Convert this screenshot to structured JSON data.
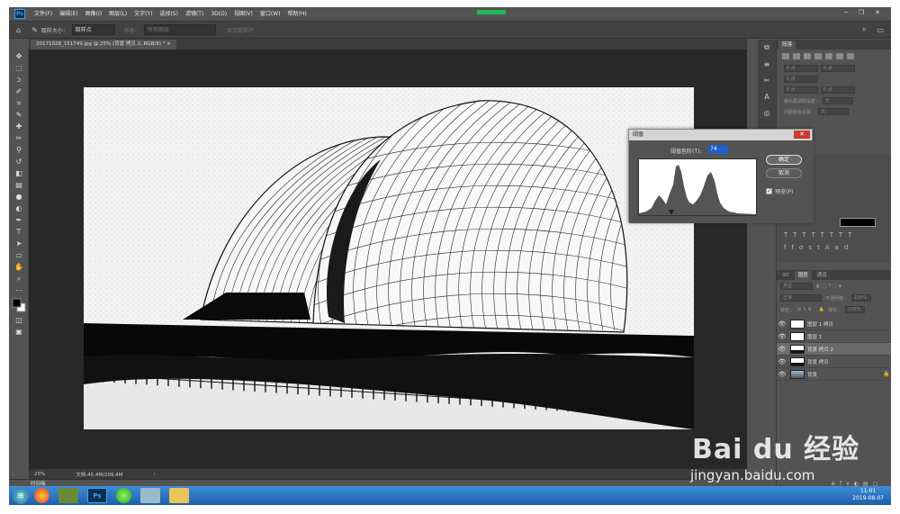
{
  "app": {
    "logo": "Ps",
    "menus": [
      "文件(F)",
      "编辑(E)",
      "图像(I)",
      "图层(L)",
      "文字(Y)",
      "选择(S)",
      "滤镜(T)",
      "3D(D)",
      "视图(V)",
      "窗口(W)",
      "帮助(H)"
    ]
  },
  "options": {
    "sample_size_label": "取样大小：",
    "sample_size_value": "取样点",
    "sample_label": "样本：",
    "sample_value": "所有图层",
    "show_ring": "显示取样环"
  },
  "document": {
    "tab_title": "20171028_151749.jpg @ 25% (背景 拷贝 2, RGB/8) *"
  },
  "status": {
    "zoom": "25%",
    "doc_size": "文档:45.4M/209.4M",
    "timeline": "时间轴"
  },
  "panels": {
    "paragraph_tab": "段落",
    "para_fields": [
      "0 点",
      "0 点",
      "0 点",
      "0 点",
      "0 点"
    ],
    "hyphen_label": "避头尾法则设置：",
    "hyphen_value": "无",
    "spacing_label": "间距组合设置：",
    "spacing_value": "无",
    "layer_tabs": [
      "3D",
      "图层",
      "通道"
    ],
    "kind_label": "类型",
    "blend_mode": "正常",
    "opacity_label": "不透明度：",
    "opacity_value": "100%",
    "lock_label": "锁定：",
    "fill_label": "填充：",
    "fill_value": "100%"
  },
  "layers": [
    {
      "name": "图层 1 拷贝",
      "selected": false,
      "locked": false
    },
    {
      "name": "图层 1",
      "selected": false,
      "locked": false
    },
    {
      "name": "背景 拷贝 2",
      "selected": true,
      "locked": false
    },
    {
      "name": "背景 拷贝",
      "selected": false,
      "locked": false
    },
    {
      "name": "背景",
      "selected": false,
      "locked": true
    }
  ],
  "dialog": {
    "title": "阈值",
    "close": "✕",
    "level_label": "阈值色阶(T):",
    "level_value": "74",
    "ok": "确定",
    "cancel": "取消",
    "preview": "预览(P)",
    "preview_checked": true
  },
  "taskbar": {
    "apps": [
      "",
      "",
      "",
      "Ps",
      "",
      "",
      ""
    ],
    "time": "11:01",
    "date": "2019-08-07"
  },
  "watermark": {
    "logo": "Bai du 经验",
    "url": "jingyan.baidu.com"
  }
}
